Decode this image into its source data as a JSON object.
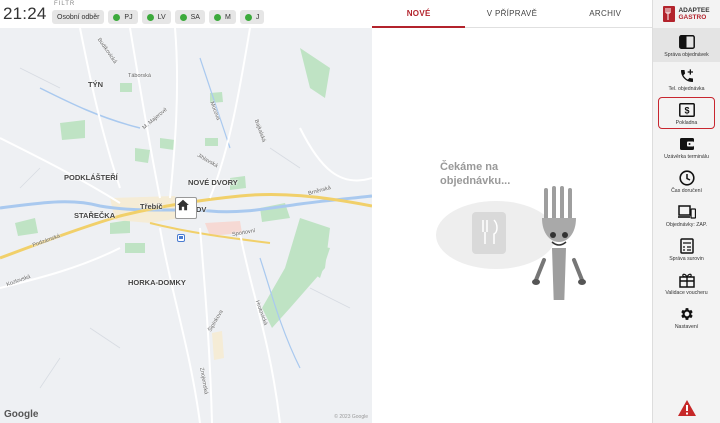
{
  "header": {
    "clock": "21:24",
    "filter_label": "FILTR",
    "chips": [
      {
        "label": "Osobní odběr",
        "dot": false
      },
      {
        "label": "PJ",
        "dot": true
      },
      {
        "label": "LV",
        "dot": true
      },
      {
        "label": "SA",
        "dot": true
      },
      {
        "label": "M",
        "dot": true
      },
      {
        "label": "J",
        "dot": true
      }
    ]
  },
  "map": {
    "labels": {
      "tyn": "TÝN",
      "podklasteri": "PODKLÁŠTEŘÍ",
      "nove_dvory": "NOVÉ DVORY",
      "starecka": "STAŘEČKA",
      "trebic": "Třebíč",
      "horka_domky": "HORKA-DOMKY",
      "budikovicka": "Budíkovická",
      "taborska": "Táborská",
      "m_majerove": "M. Majerové",
      "mocova": "Mocova",
      "bajkalska": "Bajkalská",
      "jihlavska": "Jihlavská",
      "brnenska": "Brněnská",
      "sportovni": "Sportovní",
      "podzamska": "Podzámská",
      "kozlovska": "Kozlovská",
      "hrotovicka": "Hrotovická",
      "zmajstrska": "Znojemská",
      "sipinkova": "Šipínkova",
      "dv": "DV"
    },
    "google": "Google",
    "copyright": "© 2023 Google"
  },
  "orders": {
    "tabs": [
      "NOVÉ",
      "V PŘÍPRAVĚ",
      "ARCHIV"
    ],
    "active_tab": 0,
    "empty_text_line1": "Čekáme na",
    "empty_text_line2": "objednávku..."
  },
  "nav": {
    "brand_line1": "ADAPTEE",
    "brand_line2": "GASTRO",
    "items": [
      {
        "label": "Správa objednávek",
        "icon": "orders-panel-icon"
      },
      {
        "label": "Tel. objednávka",
        "icon": "phone-add-icon"
      },
      {
        "label": "Pokladna",
        "icon": "cash-register-icon"
      },
      {
        "label": "Uzávěrka terminálu",
        "icon": "wallet-icon"
      },
      {
        "label": "Čas doručení",
        "icon": "clock-icon"
      },
      {
        "label": "Objednávky: ZAP.",
        "icon": "devices-icon"
      },
      {
        "label": "Správa surovin",
        "icon": "calculator-icon"
      },
      {
        "label": "Validace voucheru",
        "icon": "gift-icon"
      },
      {
        "label": "Nastavení",
        "icon": "gear-icon"
      }
    ]
  },
  "colors": {
    "accent": "#b3232c",
    "status_dot": "#3caa3c",
    "warning": "#c62828"
  }
}
